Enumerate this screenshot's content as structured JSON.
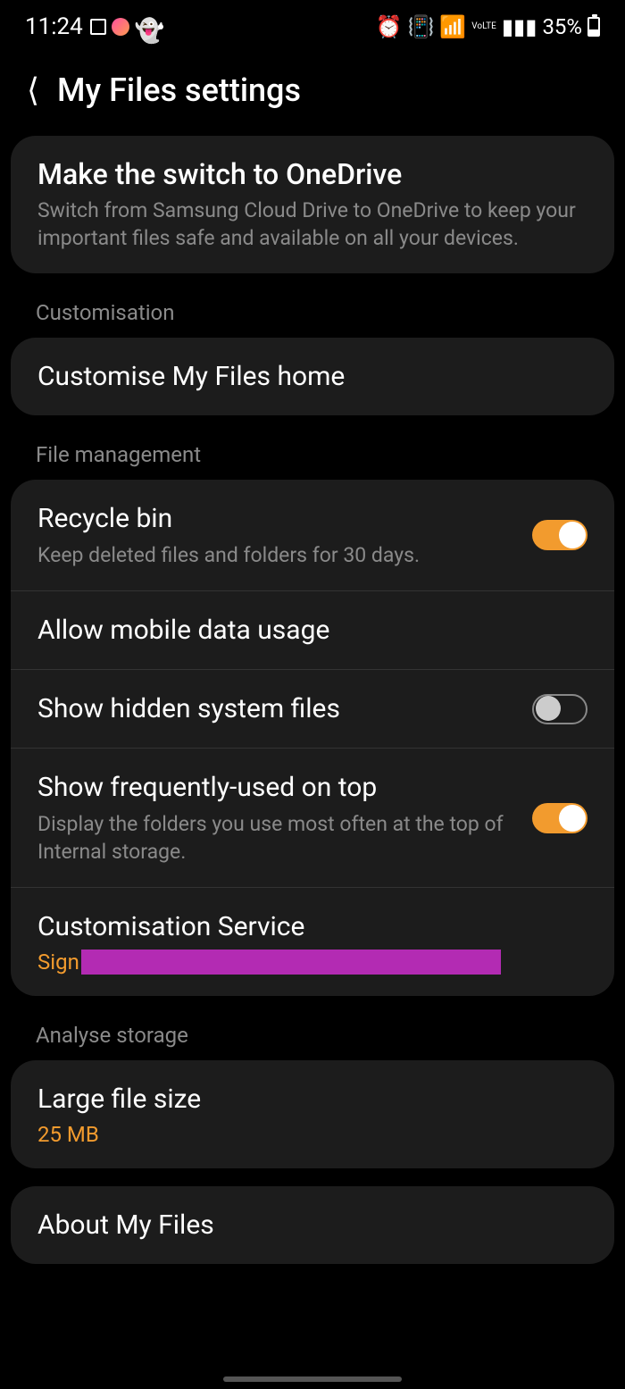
{
  "status": {
    "time": "11:24",
    "battery_percent": "35%"
  },
  "header": {
    "title": "My Files settings"
  },
  "promo": {
    "title": "Make the switch to OneDrive",
    "subtitle": "Switch from Samsung Cloud Drive to OneDrive to keep your important files safe and available on all your devices."
  },
  "sections": {
    "customisation": {
      "label": "Customisation",
      "item_title": "Customise My Files home"
    },
    "file_management": {
      "label": "File management",
      "recycle": {
        "title": "Recycle bin",
        "sub": "Keep deleted files and folders for 30 days.",
        "enabled": true
      },
      "mobile_data": {
        "title": "Allow mobile data usage"
      },
      "hidden": {
        "title": "Show hidden system files",
        "enabled": false
      },
      "frequent": {
        "title": "Show frequently-used on top",
        "sub": "Display the folders you use most often at the top of Internal storage.",
        "enabled": true
      },
      "cust_service": {
        "title": "Customisation Service",
        "signin_prefix": "Sign"
      }
    },
    "analyse": {
      "label": "Analyse storage",
      "large_file": {
        "title": "Large file size",
        "value": "25 MB"
      }
    },
    "about": {
      "title": "About My Files"
    }
  }
}
